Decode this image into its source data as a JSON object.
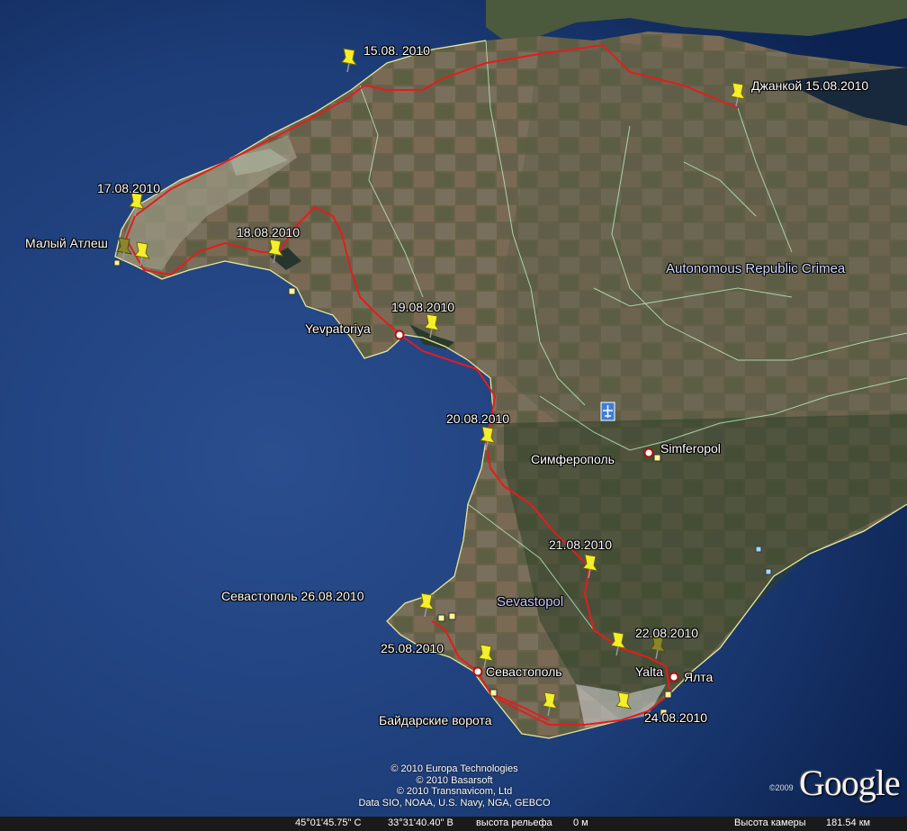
{
  "colors": {
    "route": "#e41c1c",
    "border": "#e8e89a",
    "admin": "#b7e6b7",
    "pin": "#f4ef2a"
  },
  "labels": {
    "date_1508": "15.08. 2010",
    "dzhankoy": "Джанкой 15.08.2010",
    "date_1708": "17.08.2010",
    "maly_atlesh": "Малый Атлеш",
    "date_1808": "18.08.2010",
    "yevpatoriya": "Yevpatoriya",
    "date_1908": "19.08.2010",
    "region": "Autonomous Republic Crimea",
    "date_2008": "20.08.2010",
    "simferopol_ru": "Симферополь",
    "simferopol_en": "Simferopol",
    "date_2108": "21.08.2010",
    "sevastopol_2608": "Севастополь 26.08.2010",
    "sevastopol_en": "Sevastopol",
    "date_2208": "22.08.2010",
    "date_2508": "25.08.2010",
    "sevastopol_ru": "Севастополь",
    "yalta_en": "Yalta",
    "yalta_ru": "Ялта",
    "baidar": "Байдарские ворота",
    "date_2408": "24.08.2010"
  },
  "copyright": [
    "© 2010 Europa Technologies",
    "© 2010 Basarsoft",
    "© 2010 Transnavicom, Ltd",
    "Data SIO, NOAA, U.S. Navy, NGA, GEBCO"
  ],
  "logo": {
    "text": "Google",
    "year": "©2009"
  },
  "status": {
    "lat": "45°01'45.75\" С",
    "lon": "33°31'40.40\" В",
    "elev_label": "высота рельефа",
    "elev_value": "0 м",
    "cam_label": "Высота камеры",
    "cam_value": "181.54 км"
  }
}
